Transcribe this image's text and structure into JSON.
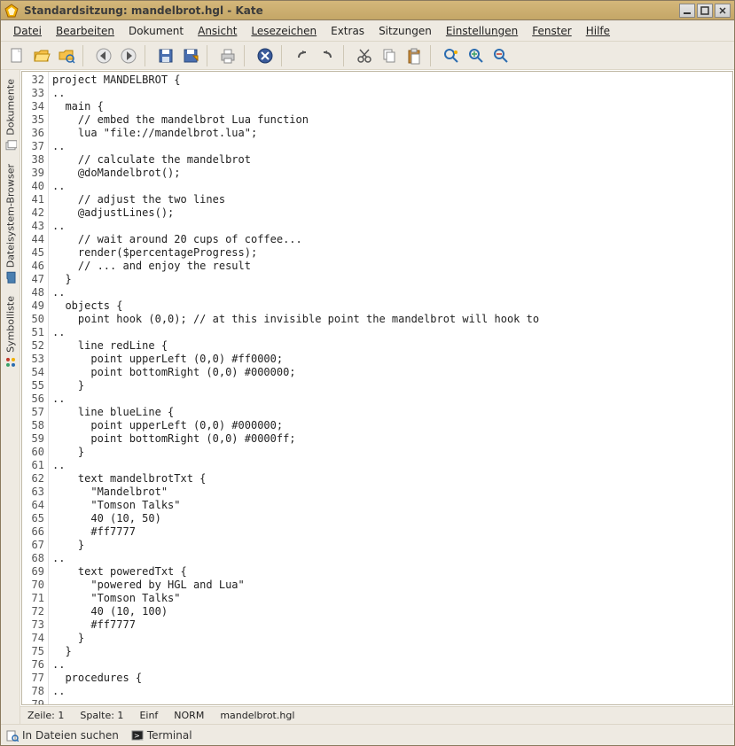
{
  "title": "Standardsitzung: mandelbrot.hgl - Kate",
  "menu": {
    "file": "Datei",
    "edit": "Bearbeiten",
    "document": "Dokument",
    "view": "Ansicht",
    "bookmarks": "Lesezeichen",
    "extras": "Extras",
    "sessions": "Sitzungen",
    "settings": "Einstellungen",
    "window": "Fenster",
    "help": "Hilfe"
  },
  "sidebar": {
    "documents": "Dokumente",
    "filesystem": "Dateisystem-Browser",
    "symbols": "Symbolliste"
  },
  "status": {
    "line": "Zeile: 1",
    "col": "Spalte: 1",
    "ins": "Einf",
    "mode": "NORM",
    "filename": "mandelbrot.hgl"
  },
  "bottom": {
    "find": "In Dateien suchen",
    "terminal": "Terminal"
  },
  "code_start_line": 32,
  "code_lines": [
    "project MANDELBROT {",
    "..",
    "  main {",
    "    // embed the mandelbrot Lua function",
    "    lua \"file://mandelbrot.lua\";",
    "..",
    "    // calculate the mandelbrot",
    "    @doMandelbrot();",
    "..",
    "    // adjust the two lines",
    "    @adjustLines();",
    "..",
    "    // wait around 20 cups of coffee...",
    "    render($percentageProgress);",
    "    // ... and enjoy the result",
    "  }",
    "..",
    "  objects {",
    "    point hook (0,0); // at this invisible point the mandelbrot will hook to",
    "..",
    "    line redLine {",
    "      point upperLeft (0,0) #ff0000;",
    "      point bottomRight (0,0) #000000;",
    "    }",
    "..",
    "    line blueLine {",
    "      point upperLeft (0,0) #000000;",
    "      point bottomRight (0,0) #0000ff;",
    "    }",
    "..",
    "    text mandelbrotTxt {",
    "      \"Mandelbrot\"",
    "      \"Tomson Talks\"",
    "      40 (10, 50)",
    "      #ff7777",
    "    }",
    "..",
    "    text poweredTxt {",
    "      \"powered by HGL and Lua\"",
    "      \"Tomson Talks\"",
    "      40 (10, 100)",
    "      #ff7777",
    "    }",
    "  }",
    "..",
    "  procedures {",
    "..",
    ""
  ]
}
